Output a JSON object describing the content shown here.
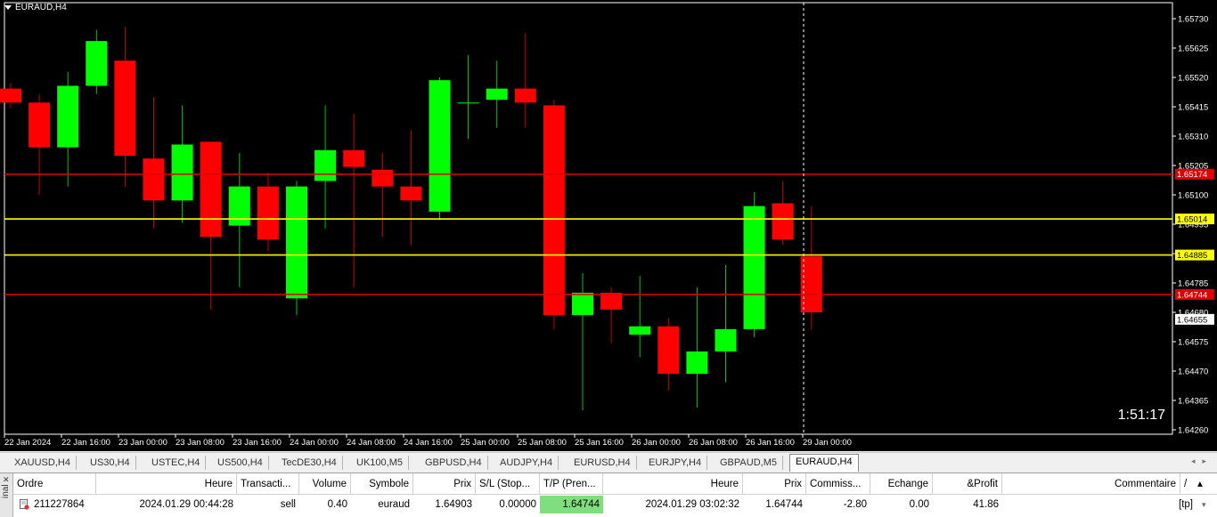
{
  "chart": {
    "title": "EURAUD,H4",
    "timer": "1:51:17",
    "colors": {
      "background": "#000000",
      "bull": "#00ff00",
      "bear": "#ff0000",
      "wick_bull": "#00c800",
      "wick_bear": "#c80000",
      "sl_line": "#e00000",
      "entry_line": "#ffff00",
      "axis_text": "#ffffff"
    },
    "price_levels": [
      "1.65730",
      "1.65625",
      "1.65520",
      "1.65415",
      "1.65310",
      "1.65205",
      "1.65100",
      "1.64995",
      "1.64890",
      "1.64785",
      "1.64680",
      "1.64575",
      "1.64470",
      "1.64365",
      "1.64260"
    ],
    "time_labels": [
      "22 Jan 2024",
      "22 Jan 16:00",
      "23 Jan 00:00",
      "23 Jan 08:00",
      "23 Jan 16:00",
      "24 Jan 00:00",
      "24 Jan 08:00",
      "24 Jan 16:00",
      "25 Jan 00:00",
      "25 Jan 08:00",
      "25 Jan 16:00",
      "26 Jan 00:00",
      "26 Jan 08:00",
      "26 Jan 16:00",
      "29 Jan 00:00"
    ],
    "marked_lines": [
      {
        "price": 1.65174,
        "label": "1.65174",
        "kind": "sl"
      },
      {
        "price": 1.65014,
        "label": "1.65014",
        "kind": "entry"
      },
      {
        "price": 1.64885,
        "label": "1.64885",
        "kind": "entry"
      },
      {
        "price": 1.64744,
        "label": "1.64744",
        "kind": "sl"
      }
    ],
    "current_price": {
      "label": "1.64655",
      "price": 1.64655
    },
    "candles": [
      {
        "o": 1.6548,
        "h": 1.655,
        "l": 1.6541,
        "c": 1.6543
      },
      {
        "o": 1.6543,
        "h": 1.6546,
        "l": 1.651,
        "c": 1.6527
      },
      {
        "o": 1.6527,
        "h": 1.6554,
        "l": 1.6513,
        "c": 1.6549
      },
      {
        "o": 1.6549,
        "h": 1.6569,
        "l": 1.6546,
        "c": 1.6565
      },
      {
        "o": 1.6558,
        "h": 1.657,
        "l": 1.6513,
        "c": 1.6524
      },
      {
        "o": 1.6523,
        "h": 1.6545,
        "l": 1.6498,
        "c": 1.6508
      },
      {
        "o": 1.6508,
        "h": 1.6542,
        "l": 1.65,
        "c": 1.6528
      },
      {
        "o": 1.6529,
        "h": 1.6529,
        "l": 1.6469,
        "c": 1.6495
      },
      {
        "o": 1.6499,
        "h": 1.6525,
        "l": 1.6477,
        "c": 1.6513
      },
      {
        "o": 1.6513,
        "h": 1.6518,
        "l": 1.649,
        "c": 1.6494
      },
      {
        "o": 1.6473,
        "h": 1.6515,
        "l": 1.6467,
        "c": 1.6513
      },
      {
        "o": 1.6515,
        "h": 1.6542,
        "l": 1.6498,
        "c": 1.6526
      },
      {
        "o": 1.6526,
        "h": 1.6539,
        "l": 1.6477,
        "c": 1.652
      },
      {
        "o": 1.6519,
        "h": 1.6525,
        "l": 1.6495,
        "c": 1.6513
      },
      {
        "o": 1.6513,
        "h": 1.6533,
        "l": 1.6492,
        "c": 1.6508
      },
      {
        "o": 1.6504,
        "h": 1.6552,
        "l": 1.6501,
        "c": 1.6551
      },
      {
        "o": 1.6543,
        "h": 1.656,
        "l": 1.653,
        "c": 1.6543
      },
      {
        "o": 1.6544,
        "h": 1.6558,
        "l": 1.6534,
        "c": 1.6548
      },
      {
        "o": 1.6548,
        "h": 1.6568,
        "l": 1.6534,
        "c": 1.6543
      },
      {
        "o": 1.6542,
        "h": 1.6544,
        "l": 1.6462,
        "c": 1.6467
      },
      {
        "o": 1.6467,
        "h": 1.6482,
        "l": 1.6433,
        "c": 1.6475
      },
      {
        "o": 1.6475,
        "h": 1.6477,
        "l": 1.6457,
        "c": 1.6469
      },
      {
        "o": 1.646,
        "h": 1.6481,
        "l": 1.6452,
        "c": 1.6463
      },
      {
        "o": 1.6463,
        "h": 1.6466,
        "l": 1.644,
        "c": 1.6446
      },
      {
        "o": 1.6446,
        "h": 1.6477,
        "l": 1.6434,
        "c": 1.6454
      },
      {
        "o": 1.6454,
        "h": 1.6485,
        "l": 1.6443,
        "c": 1.6462
      },
      {
        "o": 1.6462,
        "h": 1.6511,
        "l": 1.6459,
        "c": 1.6506
      },
      {
        "o": 1.6507,
        "h": 1.6515,
        "l": 1.6492,
        "c": 1.6494
      },
      {
        "o": 1.6488,
        "h": 1.6506,
        "l": 1.6462,
        "c": 1.6468
      }
    ]
  },
  "tabs": [
    "XAUUSD,H4",
    "US30,H4",
    "USTEC,H4",
    "US500,H4",
    "TecDE30,H4",
    "UK100,M5",
    "GBPUSD,H4",
    "AUDJPY,H4",
    "EURUSD,H4",
    "EURJPY,H4",
    "GBPAUD,M5",
    "EURAUD,H4"
  ],
  "active_tab": "EURAUD,H4",
  "terminal": {
    "side_label": "inal",
    "columns": [
      "Ordre",
      "Heure",
      "Transacti...",
      "Volume",
      "Symbole",
      "Prix",
      "S/L (Stop...",
      "T/P (Pren...",
      "Heure",
      "Prix",
      "Commiss...",
      "Echange",
      "&Profit",
      "Commentaire"
    ],
    "row": [
      "211227864",
      "2024.01.29 00:44:28",
      "sell",
      "0.40",
      "euraud",
      "1.64903",
      "0.00000",
      "1.64744",
      "2024.01.29 03:02:32",
      "1.64744",
      "-2.80",
      "0.00",
      "41.86",
      "[tp]"
    ],
    "sort_indicator": "/"
  }
}
